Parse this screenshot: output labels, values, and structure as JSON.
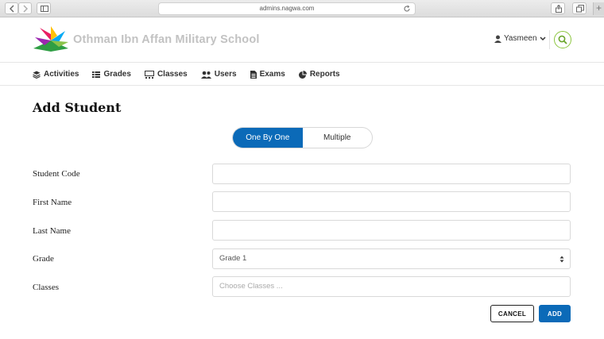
{
  "browser": {
    "url": "admins.nagwa.com",
    "new_tab_label": "+"
  },
  "header": {
    "school_name": "Othman Ibn Affan Military School",
    "user_name": "Yasmeen"
  },
  "nav": {
    "items": [
      {
        "label": "Activities",
        "icon": "layers-icon"
      },
      {
        "label": "Grades",
        "icon": "list-icon"
      },
      {
        "label": "Classes",
        "icon": "classroom-icon"
      },
      {
        "label": "Users",
        "icon": "users-icon"
      },
      {
        "label": "Exams",
        "icon": "document-icon"
      },
      {
        "label": "Reports",
        "icon": "pie-chart-icon"
      }
    ]
  },
  "page": {
    "title": "Add Student"
  },
  "mode_toggle": {
    "options": [
      "One By One",
      "Multiple"
    ],
    "selected": "One By One"
  },
  "form": {
    "student_code": {
      "label": "Student Code",
      "value": ""
    },
    "first_name": {
      "label": "First Name",
      "value": ""
    },
    "last_name": {
      "label": "Last Name",
      "value": ""
    },
    "grade": {
      "label": "Grade",
      "value": "Grade 1"
    },
    "classes": {
      "label": "Classes",
      "placeholder": "Choose Classes ..."
    }
  },
  "actions": {
    "cancel_label": "CANCEL",
    "add_label": "ADD"
  },
  "colors": {
    "primary": "#0b6ab8",
    "search_accent": "#8cc63f",
    "school_name": "#c2c2c2"
  }
}
